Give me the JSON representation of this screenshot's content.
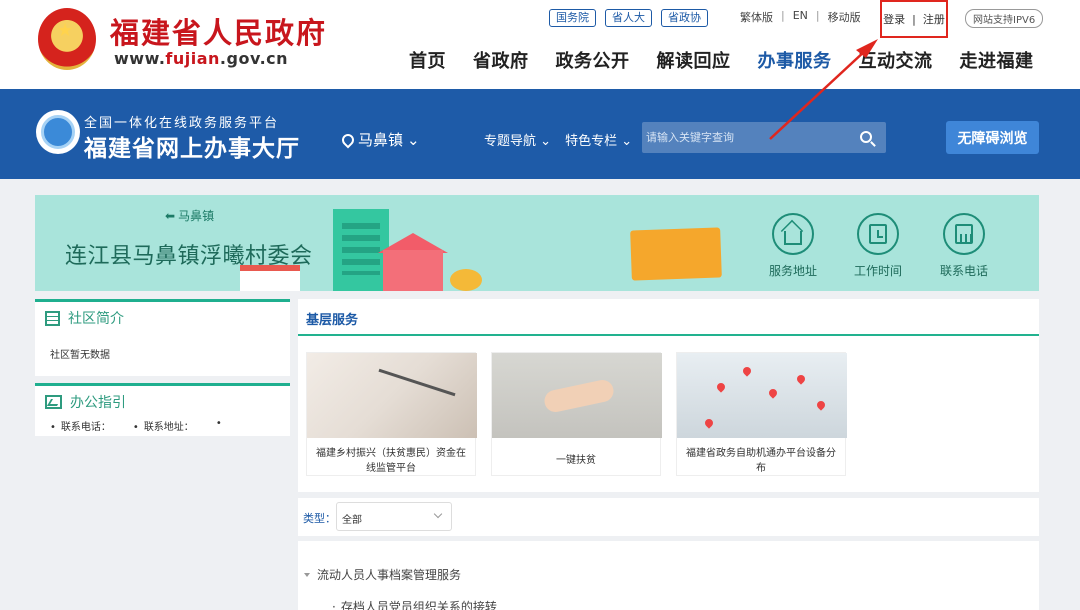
{
  "header": {
    "site_title": "福建省人民政府",
    "site_url_prefix": "www.",
    "site_url_accent": "fujian",
    "site_url_suffix": ".gov.cn",
    "top_links": [
      "国务院",
      "省人大",
      "省政协"
    ],
    "lang_links": [
      "繁体版",
      "EN",
      "移动版"
    ],
    "login": "登录",
    "register": "注册",
    "auth_sep": "|",
    "ipv6": "网站支持IPV6",
    "nav": [
      "首页",
      "省政府",
      "政务公开",
      "解读回应",
      "办事服务",
      "互动交流",
      "走进福建"
    ],
    "nav_active_index": 4
  },
  "hall": {
    "subtitle": "全国一体化在线政务服务平台",
    "title": "福建省网上办事大厅",
    "location": "马鼻镇",
    "nav": [
      "专题导航",
      "特色专栏"
    ],
    "search_placeholder": "请输入关键字查询",
    "accessibility_button": "无障碍浏览"
  },
  "banner": {
    "back_label": "马鼻镇",
    "village_name": "连江县马鼻镇浮曦村委会",
    "quick_links": [
      {
        "label": "服务地址",
        "icon": "home-icon"
      },
      {
        "label": "工作时间",
        "icon": "clock-icon"
      },
      {
        "label": "联系电话",
        "icon": "phone-icon"
      }
    ]
  },
  "community": {
    "heading": "社区简介",
    "text": "社区暂无数据"
  },
  "office_guide": {
    "heading": "办公指引",
    "phone_label": "联系电话：",
    "address_label": "联系地址：",
    "extra": ""
  },
  "services": {
    "heading": "基层服务",
    "cards": [
      {
        "title": "福建乡村振兴（扶贫惠民）资金在线监管平台"
      },
      {
        "title": "一键扶贫"
      },
      {
        "title": "福建省政务自助机通办平台设备分布"
      }
    ]
  },
  "filter": {
    "label": "类型：",
    "selected": "全部"
  },
  "tree": {
    "node": "流动人员人事档案管理服务",
    "child": "存档人员党员组织关系的接转"
  },
  "colors": {
    "brand_red": "#c8161d",
    "hall_blue": "#1e5ba8",
    "accent_green": "#1faf8f",
    "annotation_red": "#e0261e"
  }
}
